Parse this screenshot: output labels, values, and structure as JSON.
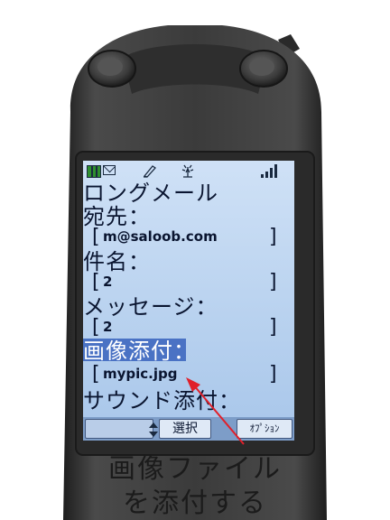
{
  "status_bar": {
    "icons": [
      "battery-icon",
      "mail-icon",
      "pen-icon",
      "antenna-icon",
      "signal-icon"
    ]
  },
  "screen": {
    "title": "ロングメール",
    "to_label": "宛先：",
    "to_value": "m@saloob.com",
    "subject_label": "件名：",
    "subject_value": "2",
    "message_label": "メッセージ：",
    "message_value": "2",
    "image_attach_label": "画像添付：",
    "image_attach_value": "mypic.jpg",
    "sound_attach_label": "サウンド添付：",
    "bracket_open": "[",
    "bracket_close": "]"
  },
  "softkeys": {
    "center": "選択",
    "right": "ｵﾌﾟｼｮﾝ"
  },
  "caption": {
    "line1": "画像ファイル",
    "line2": "を添付する"
  },
  "colors": {
    "screen_bg": "#b9d2ef",
    "highlight": "#4a72c4",
    "arrow": "#e0202a",
    "phone_body": "#3a3a3a"
  }
}
